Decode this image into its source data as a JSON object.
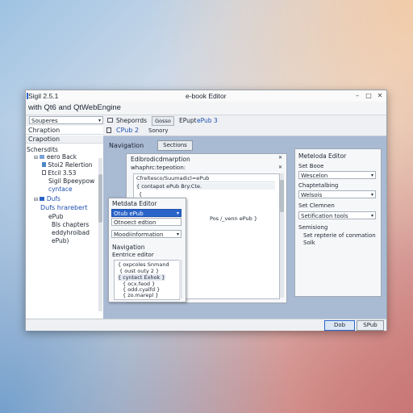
{
  "window": {
    "title_left": "Sigil 2.5.1",
    "title_center": "e-book Editor",
    "subtitle": "with Qt6 and QtWebEngine",
    "controls": {
      "minimize": "–",
      "maximize": "□",
      "close": "✕"
    }
  },
  "toolbar": {
    "combo_value": "Souperes",
    "label_1": "Sheporrds",
    "button": "Gosso",
    "label_2": "EPupt",
    "label_3": "ePub 3"
  },
  "left_pane": {
    "header_1": "Chraption",
    "header_2": "Crapotion",
    "tree_header": "Schersdits",
    "items": [
      {
        "text": "eero Back"
      },
      {
        "text": "Stoi2 Relertion"
      },
      {
        "text": "Etcil 3.53"
      },
      {
        "text": "Sigil Bpeeypow"
      },
      {
        "text": "cyntace"
      },
      {
        "text": "Dufs"
      },
      {
        "text": "Dufs hrarebert"
      },
      {
        "text": "ePub"
      },
      {
        "text": "Bls chapters"
      },
      {
        "text": "eddyhroibad"
      },
      {
        "text": "ePub)"
      }
    ]
  },
  "center": {
    "tab_label": "CPub 2",
    "tab_label_2": "Sonory",
    "nav_label": "Navigation",
    "sections_button": "Sections",
    "edit_panel": {
      "title": "Edibrodicdmarption",
      "subtitle": "whaphrc:tepeotion:",
      "lines": [
        "Cfreltesco/Suumadicl=ePub",
        "{ contapot ePub Bry:Cte.",
        "{",
        "{",
        "{",
        "Pos /_venn ePub }"
      ]
    },
    "metadata_popup": {
      "title": "Metdata Editor",
      "combo_1": "Otub ePub",
      "combo_2": "Otnoect edtion",
      "combo_3": "Moodiinformation",
      "nav_title": "Navigation",
      "nav_sub": "Eentrice editor",
      "lines": [
        "{ oxpcoles Snmand",
        "{ oust outy 2 }",
        "{ cyntect Exhok }",
        "{ ocx.feod }",
        "{ odd.cyalfd }",
        "{ zo.marepl }"
      ]
    }
  },
  "right_panel": {
    "title": "Meteloda Editor",
    "label_1": "Set Booe",
    "combo_1": "Wescelon",
    "label_2": "Chaptetalbing",
    "combo_2": "Welsois",
    "label_3": "Set Clemnen",
    "combo_3": "Setification tools",
    "label_4": "Semisiong",
    "text_1": "Set repterie of conmation",
    "text_2": "Solk"
  },
  "statusbar": {
    "button_1": "Dob",
    "button_2": "SPub"
  },
  "colors": {
    "accent": "#2a64c9",
    "center_bg": "#a9bad3",
    "link": "#1e4fb0"
  }
}
